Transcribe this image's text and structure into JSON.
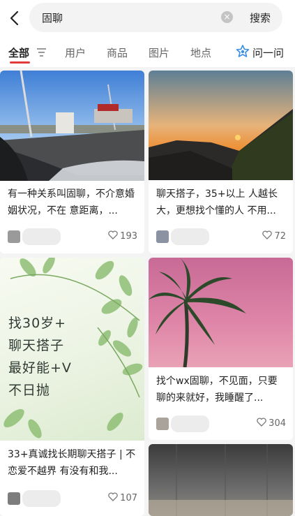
{
  "search": {
    "query": "固聊",
    "submit_label": "搜索"
  },
  "tabs": [
    {
      "label": "全部",
      "active": true
    },
    {
      "label": "用户"
    },
    {
      "label": "商品"
    },
    {
      "label": "图片"
    },
    {
      "label": "地点"
    }
  ],
  "ask": {
    "label": "问一问"
  },
  "colors": {
    "accent": "#e23b3b",
    "ask_icon": "#3a8ee6"
  },
  "posts": [
    {
      "title": "有一种关系叫固聊，不介意婚姻状况，不在 意距离，...",
      "likes": "193",
      "image": "highway-car-view"
    },
    {
      "title": "聊天搭子，35+以上 人越长大，更想找个懂的人 不用...",
      "likes": "72",
      "image": "mountain-sunset"
    },
    {
      "title": "33+真诚找长期聊天搭子 | 不恋爱不越界 有没有和我...",
      "likes": "107",
      "image": "green-leaves-poster",
      "poster_lines": [
        "找30岁+",
        "聊天搭子",
        "最好能+V",
        "不日抛"
      ]
    },
    {
      "title": "找个wx固聊，不见面，只要聊的来就好，我睡醒了...",
      "likes": "304",
      "image": "palm-tree-pink-sky"
    },
    {
      "title": "",
      "likes": "",
      "image": "gray-interior"
    }
  ]
}
